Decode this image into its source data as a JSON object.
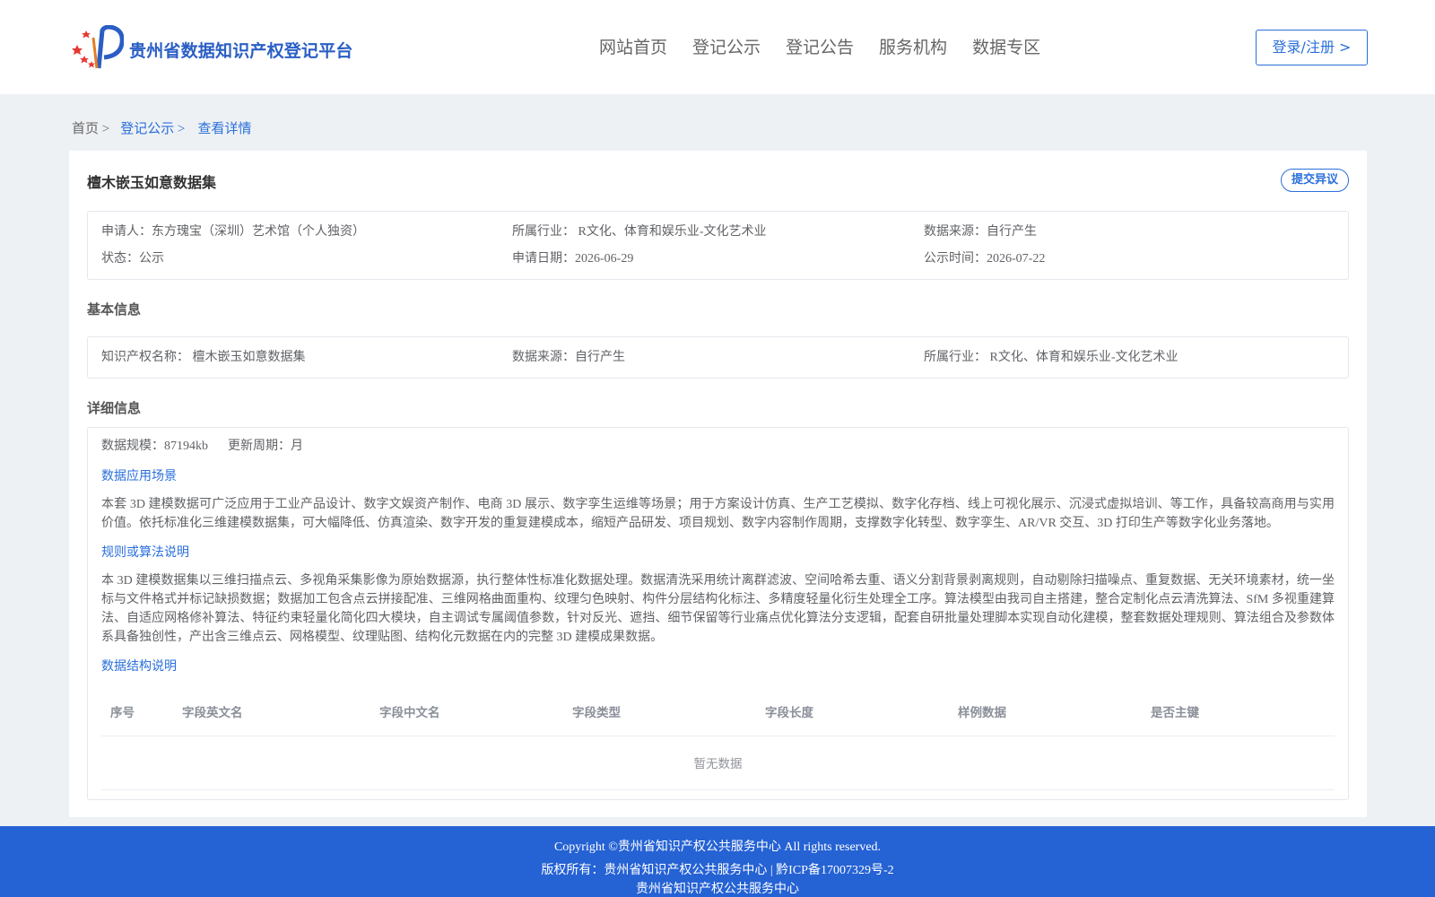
{
  "header": {
    "site_title": "贵州省数据知识产权登记平台",
    "nav": [
      "网站首页",
      "登记公示",
      "登记公告",
      "服务机构",
      "数据专区"
    ],
    "login": "登录/注册 >"
  },
  "breadcrumb": {
    "home": "首页 >",
    "list": "登记公示 >",
    "current": "查看详情"
  },
  "dataset": {
    "title": "檀木嵌玉如意数据集",
    "objection_button": "提交异议",
    "summary": [
      "申请人：东方瑰宝（深圳）艺术馆（个人独资）",
      "所属行业： R文化、体育和娱乐业-文化艺术业",
      "数据来源：自行产生",
      "状态：公示",
      "申请日期：2026-06-29",
      "公示时间：2026-07-22"
    ]
  },
  "basic": {
    "section_title": "基本信息",
    "fields": [
      "知识产权名称： 檀木嵌玉如意数据集",
      "数据来源：自行产生",
      "所属行业： R文化、体育和娱乐业-文化艺术业"
    ]
  },
  "detail": {
    "section_title": "详细信息",
    "scale": "数据规模：87194kb",
    "cycle": "更新周期：月",
    "scenario_title": "数据应用场景",
    "scenario_text": "本套 3D 建模数据可广泛应用于工业产品设计、数字文娱资产制作、电商 3D 展示、数字孪生运维等场景；用于方案设计仿真、生产工艺模拟、数字化存档、线上可视化展示、沉浸式虚拟培训、等工作，具备较高商用与实用价值。依托标准化三维建模数据集，可大幅降低、仿真渲染、数字开发的重复建模成本，缩短产品研发、项目规划、数字内容制作周期，支撑数字化转型、数字孪生、AR/VR 交互、3D 打印生产等数字化业务落地。",
    "rules_title": "规则或算法说明",
    "rules_text": "本 3D 建模数据集以三维扫描点云、多视角采集影像为原始数据源，执行整体性标准化数据处理。数据清洗采用统计离群滤波、空间哈希去重、语义分割背景剥离规则，自动剔除扫描噪点、重复数据、无关环境素材，统一坐标与文件格式并标记缺损数据；数据加工包含点云拼接配准、三维网格曲面重构、纹理匀色映射、构件分层结构化标注、多精度轻量化衍生处理全工序。算法模型由我司自主搭建，整合定制化点云清洗算法、SfM 多视重建算法、自适应网格修补算法、特征约束轻量化简化四大模块，自主调试专属阈值参数，针对反光、遮挡、细节保留等行业痛点优化算法分支逻辑，配套自研批量处理脚本实现自动化建模，整套数据处理规则、算法组合及参数体系具备独创性，产出含三维点云、网格模型、纹理贴图、结构化元数据在内的完整 3D 建模成果数据。",
    "structure_title": "数据结构说明",
    "table": {
      "columns": [
        "序号",
        "字段英文名",
        "字段中文名",
        "字段类型",
        "字段长度",
        "样例数据",
        "是否主键"
      ],
      "empty": "暂无数据"
    }
  },
  "footer": {
    "line1": "Copyright ©贵州省知识产权公共服务中心 All rights reserved.",
    "line2": "版权所有：贵州省知识产权公共服务中心 | 黔ICP备17007329号-2",
    "line3": "贵州省知识产权公共服务中心"
  }
}
